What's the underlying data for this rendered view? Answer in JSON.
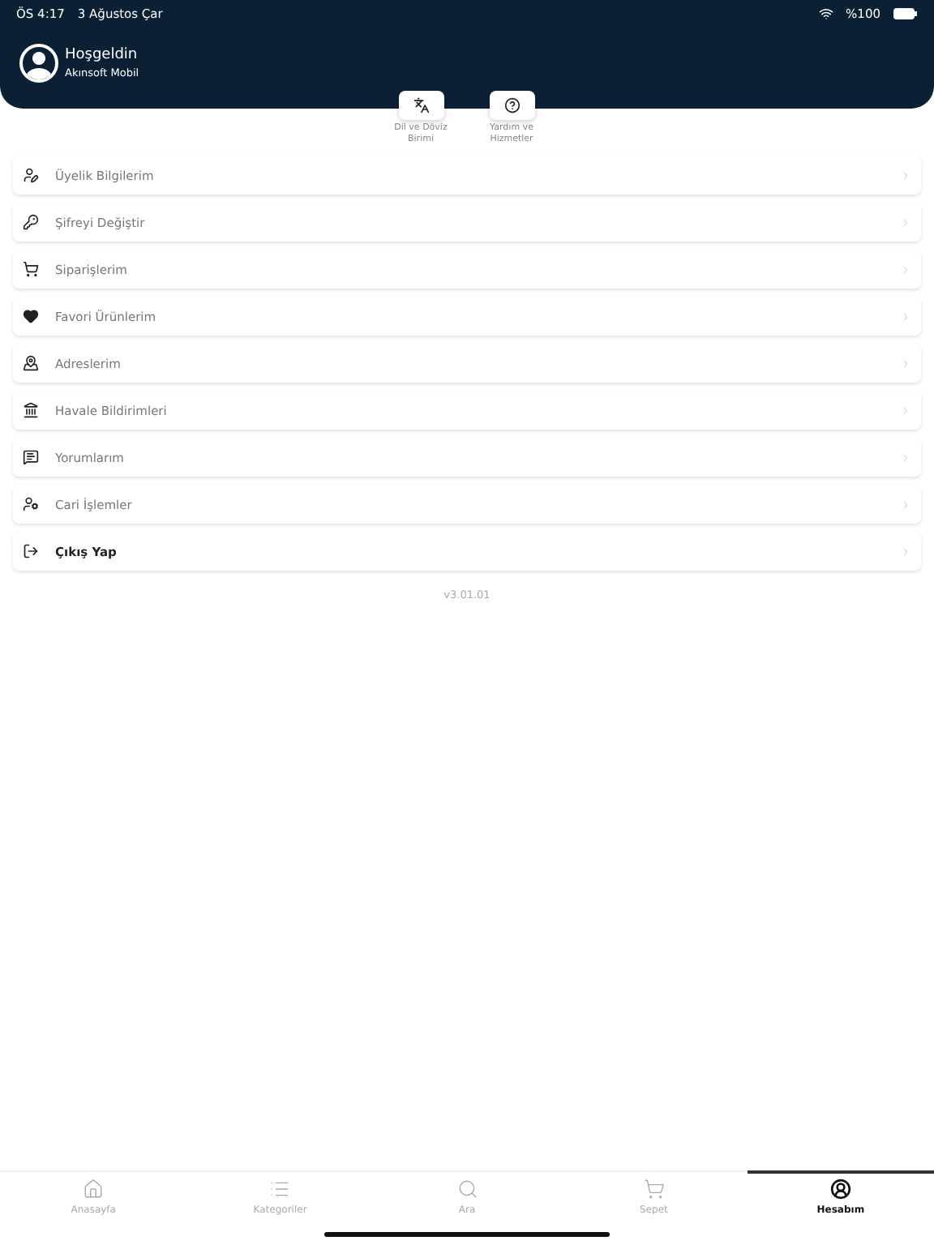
{
  "status_bar": {
    "time": "ÖS 4:17",
    "date": "3 Ağustos Çar",
    "battery": "%100"
  },
  "header": {
    "greeting": "Hoşgeldin",
    "user": "Akınsoft Mobil"
  },
  "quick_actions": [
    {
      "label": "Dil ve Döviz Birimi"
    },
    {
      "label": "Yardım ve Hizmetler"
    }
  ],
  "menu": [
    {
      "label": "Üyelik Bilgilerim",
      "kind": "normal"
    },
    {
      "label": "Şifreyi Değiştir",
      "kind": "normal"
    },
    {
      "label": "Siparişlerim",
      "kind": "normal"
    },
    {
      "label": "Favori Ürünlerim",
      "kind": "normal"
    },
    {
      "label": "Adreslerim",
      "kind": "normal"
    },
    {
      "label": "Havale Bildirimleri",
      "kind": "normal"
    },
    {
      "label": "Yorumlarım",
      "kind": "normal"
    },
    {
      "label": "Cari İşlemler",
      "kind": "normal"
    },
    {
      "label": "Çıkış Yap",
      "kind": "logout"
    }
  ],
  "version": "v3.01.01",
  "tab_bar": [
    {
      "label": "Anasayfa",
      "selected": false
    },
    {
      "label": "Kategoriler",
      "selected": false
    },
    {
      "label": "Ara",
      "selected": false
    },
    {
      "label": "Sepet",
      "selected": false
    },
    {
      "label": "Hesabım",
      "selected": true
    }
  ]
}
